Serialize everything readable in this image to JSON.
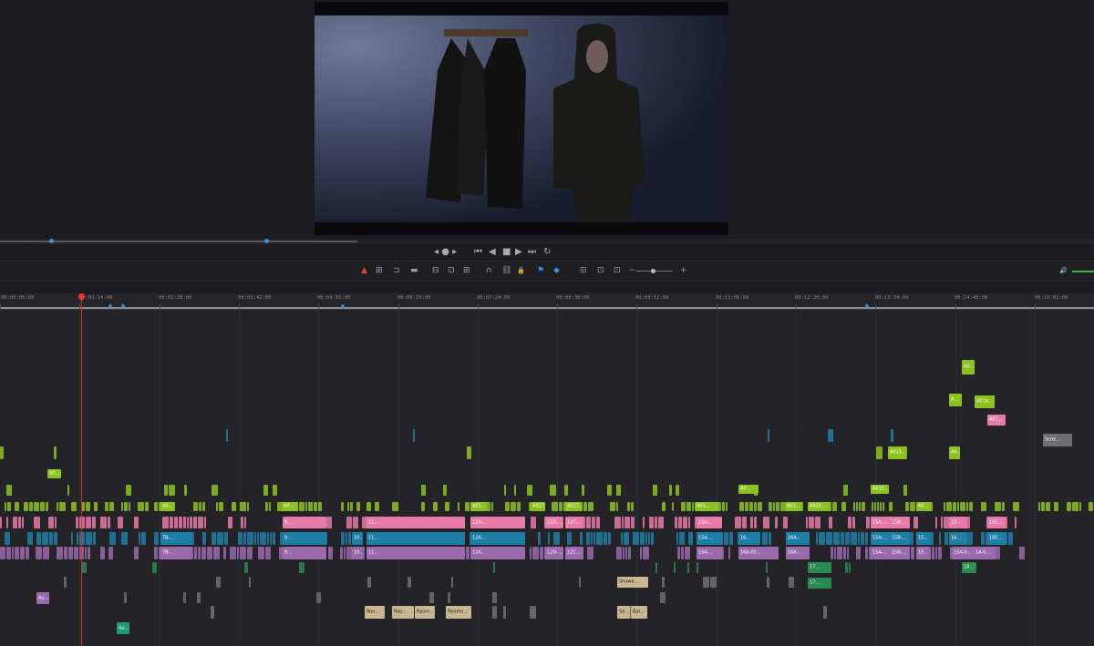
{
  "viewer": {
    "image_description": "person in hooded sweatshirt standing beside coats on wall hooks"
  },
  "transport": {
    "jog": "◂ ● ▸",
    "first": "⏮",
    "prev": "◀",
    "stop": "■",
    "play": "▶",
    "last": "⏭",
    "loop": "↻"
  },
  "toolbar": {
    "select": "▲",
    "trim": "⊞",
    "blade": "⊐",
    "edit": "▬",
    "overwrite": "⊟",
    "replace": "⊡",
    "fit": "⊞",
    "snap": "∩",
    "link": "⛓",
    "lock": "🔒",
    "flag": "⚑",
    "marker": "◆",
    "zoom1": "⊟",
    "zoom2": "⊡",
    "zoom3": "⊡",
    "zoom_minus": "−",
    "zoom_plus": "+",
    "volume": "🔊"
  },
  "ruler": {
    "timecodes": [
      "00:00:00:00",
      "00:01:14:00",
      "00:02:28:00",
      "00:03:42:00",
      "00:04:56:00",
      "00:06:10:00",
      "00:07:24:00",
      "00:08:38:00",
      "00:09:52:00",
      "00:11:06:00",
      "00:12:20:00",
      "00:13:34:00",
      "00:14:48:00",
      "00:16:02:00"
    ]
  },
  "colors": {
    "lime": "#8dc21c",
    "green": "#2a8a50",
    "teal": "#1f9a72",
    "pink": "#e77aa8",
    "blue": "#1e7fa6",
    "purple": "#9a6aad",
    "tan": "#c9b793",
    "gray": "#6e6e74",
    "salmon": "#c48a6e"
  },
  "clips": [
    [
      "lime",
      "A0...",
      52,
      515,
      15,
      10
    ],
    [
      "lime",
      "A0...",
      176,
      551,
      16,
      10
    ],
    [
      "lime",
      "A0...",
      309,
      551,
      18,
      10
    ],
    [
      "lime",
      "A01...",
      516,
      551,
      18,
      10
    ],
    [
      "lime",
      "A017...",
      582,
      551,
      16,
      10
    ],
    [
      "lime",
      "A017...",
      620,
      551,
      18,
      10
    ],
    [
      "lime",
      "A01...",
      762,
      551,
      26,
      10
    ],
    [
      "lime",
      "A0...",
      810,
      532,
      22,
      10
    ],
    [
      "lime",
      "A01...",
      861,
      551,
      18,
      10
    ],
    [
      "lime",
      "A015...",
      886,
      551,
      24,
      10
    ],
    [
      "lime",
      "A015...",
      955,
      532,
      20,
      10
    ],
    [
      "lime",
      "A015...",
      974,
      490,
      20,
      14
    ],
    [
      "lime",
      "A0...",
      1005,
      551,
      16,
      10
    ],
    [
      "lime",
      "A0...",
      1041,
      490,
      12,
      14
    ],
    [
      "lime",
      "A...",
      1041,
      432,
      14,
      14
    ],
    [
      "lime",
      "A014...",
      1069,
      434,
      22,
      14
    ],
    [
      "pink",
      "A01...",
      1083,
      455,
      20,
      12
    ],
    [
      "lime",
      "A0...",
      1055,
      395,
      14,
      16
    ],
    [
      "pink",
      "9...",
      310,
      567,
      48,
      13
    ],
    [
      "pink",
      "11...",
      402,
      567,
      108,
      13
    ],
    [
      "pink",
      "12A-...",
      516,
      567,
      60,
      13
    ],
    [
      "pink",
      "12D-...",
      598,
      567,
      20,
      13
    ],
    [
      "pink",
      "12C...",
      620,
      567,
      20,
      13
    ],
    [
      "pink",
      "15A-...",
      764,
      567,
      28,
      13
    ],
    [
      "pink",
      "15A-...",
      955,
      567,
      22,
      13
    ],
    [
      "pink",
      "15B-...",
      976,
      567,
      22,
      13
    ],
    [
      "pink",
      "15...",
      1041,
      567,
      20,
      13
    ],
    [
      "pink",
      "18E...",
      1083,
      567,
      20,
      13
    ],
    [
      "blue",
      "7B-...",
      176,
      584,
      34,
      14
    ],
    [
      "blue",
      "9...",
      310,
      584,
      48,
      14
    ],
    [
      "blue",
      "10...",
      386,
      584,
      12,
      14
    ],
    [
      "blue",
      "11...",
      402,
      584,
      108,
      14
    ],
    [
      "blue",
      "12A...",
      516,
      584,
      60,
      14
    ],
    [
      "blue",
      "15A-...",
      764,
      584,
      28,
      14
    ],
    [
      "blue",
      "16...",
      810,
      584,
      24,
      14
    ],
    [
      "blue",
      "16A...",
      862,
      584,
      26,
      14
    ],
    [
      "blue",
      "15A-...",
      955,
      584,
      22,
      14
    ],
    [
      "blue",
      "15B-...",
      976,
      584,
      22,
      14
    ],
    [
      "blue",
      "15...",
      1005,
      584,
      16,
      14
    ],
    [
      "blue",
      "16...",
      1041,
      584,
      20,
      14
    ],
    [
      "blue",
      "18E...",
      1083,
      584,
      20,
      14
    ],
    [
      "purple",
      "7B-...",
      176,
      600,
      34,
      14
    ],
    [
      "purple",
      "9...",
      310,
      600,
      48,
      14
    ],
    [
      "purple",
      "10...",
      386,
      600,
      12,
      14
    ],
    [
      "purple",
      "11...",
      402,
      600,
      108,
      14
    ],
    [
      "purple",
      "12A...",
      516,
      600,
      60,
      14
    ],
    [
      "purple",
      "12D-...",
      598,
      600,
      20,
      14
    ],
    [
      "purple",
      "12C...",
      620,
      600,
      20,
      14
    ],
    [
      "purple",
      "15A-...",
      764,
      600,
      28,
      14
    ],
    [
      "purple",
      "16b-00...",
      810,
      600,
      44,
      14
    ],
    [
      "purple",
      "16A...",
      862,
      600,
      26,
      14
    ],
    [
      "purple",
      "15A-...",
      955,
      600,
      22,
      14
    ],
    [
      "purple",
      "15B-...",
      976,
      600,
      22,
      14
    ],
    [
      "purple",
      "15...",
      1005,
      600,
      16,
      14
    ],
    [
      "purple",
      "15A-0...",
      1044,
      600,
      28,
      14
    ],
    [
      "purple",
      "1A-0...",
      1068,
      600,
      24,
      14
    ],
    [
      "green",
      "17...",
      886,
      617,
      26,
      12
    ],
    [
      "green",
      "17...",
      886,
      634,
      26,
      12
    ],
    [
      "green",
      "18...",
      1055,
      617,
      16,
      12
    ],
    [
      "tan",
      "Showe...",
      677,
      633,
      34,
      12
    ],
    [
      "tan",
      "Sa...",
      677,
      665,
      14,
      14
    ],
    [
      "tan",
      "Bat...",
      692,
      665,
      18,
      14
    ],
    [
      "tan",
      "Roo...",
      400,
      665,
      22,
      14
    ],
    [
      "tan",
      "Roo...",
      430,
      665,
      24,
      14
    ],
    [
      "tan",
      "Room...",
      455,
      665,
      22,
      14
    ],
    [
      "tan",
      "Roomo...",
      489,
      665,
      28,
      14
    ],
    [
      "purple",
      "Au...",
      40,
      650,
      14,
      13
    ],
    [
      "teal",
      "Au...",
      128,
      683,
      14,
      13
    ],
    [
      "gray",
      "Screi...",
      1144,
      476,
      32,
      14
    ]
  ]
}
